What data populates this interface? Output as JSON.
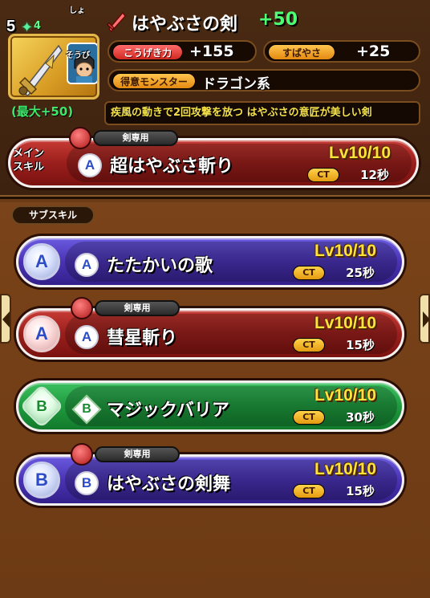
{
  "item": {
    "rarity": "5",
    "upgrade": "4",
    "name": "はやぶさの剣",
    "plus": "+50",
    "max_bonus": "(最大+50)",
    "badge_top": "しょ",
    "badge_bottom": "そうび",
    "description": "疾風の動きで2回攻撃を放つ はやぶさの意匠が美しい剣"
  },
  "stats": {
    "attack_label": "こうげき力",
    "attack_value": "+155",
    "speed_label": "すばやさ",
    "speed_value": "+25",
    "monster_label": "得意モンスター",
    "monster_value": "ドラゴン系"
  },
  "main_skill": {
    "label_line1": "メイン",
    "label_line2": "スキル",
    "exclusive_tag": "剣専用",
    "type": "A",
    "name": "超はやぶさ斬り",
    "level": "Lv10/10",
    "ct_label": "CT",
    "ct_value": "12秒"
  },
  "sub_skills": {
    "title": "サブスキル",
    "items": [
      {
        "type": "A",
        "mini_type": "A",
        "name": "たたかいの歌",
        "level": "Lv10/10",
        "ct_label": "CT",
        "ct_value": "25秒",
        "exclusive_tag": ""
      },
      {
        "type": "A",
        "mini_type": "A",
        "name": "彗星斬り",
        "level": "Lv10/10",
        "ct_label": "CT",
        "ct_value": "15秒",
        "exclusive_tag": "剣専用"
      },
      {
        "type": "B",
        "mini_type": "B",
        "name": "マジックバリア",
        "level": "Lv10/10",
        "ct_label": "CT",
        "ct_value": "30秒",
        "exclusive_tag": ""
      },
      {
        "type": "B",
        "mini_type": "B",
        "name": "はやぶさの剣舞",
        "level": "Lv10/10",
        "ct_label": "CT",
        "ct_value": "15秒",
        "exclusive_tag": "剣専用"
      }
    ]
  },
  "colors": {
    "gold": "#ffe23a",
    "green_plus": "#4cff74",
    "bar_red": "#9a1f1c",
    "bar_blue": "#4a33b4",
    "bar_green": "#1f9a3e"
  },
  "icons": {
    "star": "star-icon",
    "sword": "sword-icon",
    "weapon": "falcon-sword-icon",
    "monster": "monster-face-icon",
    "nav_left": "chevron-left-icon",
    "nav_right": "chevron-right-icon"
  }
}
